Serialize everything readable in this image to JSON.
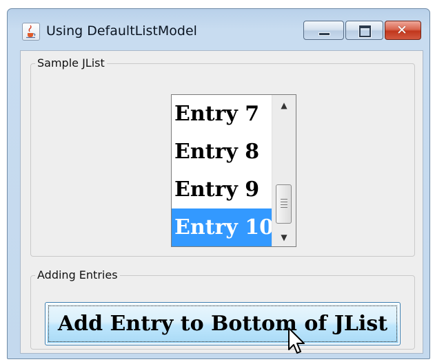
{
  "window": {
    "title": "Using DefaultListModel",
    "icon": "java-cup-icon"
  },
  "title_buttons": {
    "minimize": "minimize-icon",
    "maximize": "maximize-icon",
    "close": "close-icon",
    "close_glyph": "✕"
  },
  "groups": {
    "sample_list": {
      "label": "Sample JList",
      "items": [
        "Entry 7",
        "Entry 8",
        "Entry 9",
        "Entry 10"
      ],
      "selected": "Entry 10",
      "scroll_up_glyph": "▲",
      "scroll_down_glyph": "▼"
    },
    "adding_entries": {
      "label": "Adding Entries",
      "button_label": "Add Entry to Bottom of JList"
    }
  },
  "colors": {
    "selection": "#3399ff",
    "close_button": "#c1371d",
    "button_face": "#bee6fd"
  }
}
